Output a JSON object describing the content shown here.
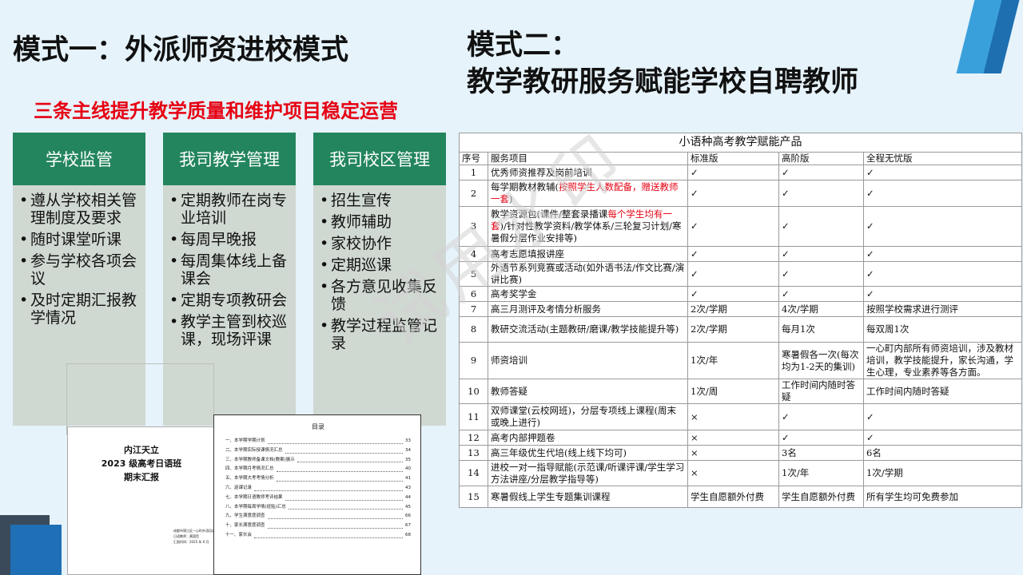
{
  "mode1": {
    "title": "模式一：外派师资进校模式"
  },
  "mode2": {
    "title_line1": "模式二：",
    "title_line2": "教学教研服务赋能学校自聘教师"
  },
  "subtitle": "三条主线提升教学质量和维护项目稳定运营",
  "columns": [
    {
      "header": "学校监管",
      "items": [
        "遵从学校相关管理制度及要求",
        "随时课堂听课",
        "参与学校各项会议",
        "及时定期汇报教学情况"
      ]
    },
    {
      "header": "我司教学管理",
      "items": [
        "定期教师在岗专业培训",
        "每周早晚报",
        "每周集体线上备课会",
        "定期专项教研会",
        "教学主管到校巡课，现场评课"
      ]
    },
    {
      "header": "我司校区管理",
      "items": [
        "招生宣传",
        "教师辅助",
        "家校协作",
        "定期巡课",
        "各方意见收集反馈",
        "教学过程监管记录"
      ]
    }
  ],
  "report_cover": {
    "line1": "内江天立",
    "line2": "2023 级高考日语班",
    "line3": "期末汇报",
    "meta": [
      "成都市锦江区一心町外语培训学校",
      "日语教师：黄国哲",
      "汇报时间：2025 年 6 月"
    ]
  },
  "toc": {
    "title": "目录",
    "entries": [
      {
        "t": "一、本学期学期计划",
        "p": "33"
      },
      {
        "t": "二、本学期实际授课情况汇总",
        "p": "34"
      },
      {
        "t": "三、本学期教师备课文档(教案)展示",
        "p": "35"
      },
      {
        "t": "四、本学期月考情况汇总",
        "p": "40"
      },
      {
        "t": "五、本学期大考考情分析",
        "p": "41"
      },
      {
        "t": "六、巡课记录",
        "p": "43"
      },
      {
        "t": "七、本学期日语教师考评结果",
        "p": "44"
      },
      {
        "t": "八、本学期每周学情(班貼)汇总",
        "p": "45"
      },
      {
        "t": "九、学生满意度调查",
        "p": "66"
      },
      {
        "t": "十、家长满意度调查",
        "p": "67"
      },
      {
        "t": "十一、家长会",
        "p": "68"
      }
    ]
  },
  "table": {
    "caption": "小语种高考教学赋能产品",
    "headers": [
      "序号",
      "服务项目",
      "标准版",
      "高阶版",
      "全程无忧版"
    ],
    "rows": [
      {
        "n": "1",
        "item": "优秀师资推荐及岗前培训",
        "std": "✓",
        "adv": "✓",
        "full": "✓"
      },
      {
        "n": "2",
        "item": "每学期教材教辅(",
        "item_red": "按照学生人数配备，赠送教师一套",
        "item_tail": ")",
        "std": "✓",
        "adv": "✓",
        "full": "✓"
      },
      {
        "n": "3",
        "item": "教学资源包(课件/整套录播课",
        "item_red": "每个学生均有一套",
        "item_tail": ")/针对性教学资料/教学体系/三轮复习计划/寒暑假分层作业安排等)",
        "std": "✓",
        "adv": "✓",
        "full": "✓"
      },
      {
        "n": "4",
        "item": "高考志愿填报讲座",
        "std": "✓",
        "adv": "✓",
        "full": "✓"
      },
      {
        "n": "5",
        "item": "外语节系列竞赛或活动(如外语书法/作文比赛/演讲比赛)",
        "std": "✓",
        "adv": "✓",
        "full": "✓"
      },
      {
        "n": "6",
        "item": "高考奖学金",
        "std": "✓",
        "adv": "✓",
        "full": "✓"
      },
      {
        "n": "7",
        "item": "高三月测评及考情分析服务",
        "std": "2次/学期",
        "adv": "4次/学期",
        "full": "按照学校需求进行测评"
      },
      {
        "n": "8",
        "item": "教研交流活动(主题教研/磨课/教学技能提升等)",
        "std": "2次/学期",
        "adv": "每月1次",
        "full": "每双周1次"
      },
      {
        "n": "9",
        "item": "师资培训",
        "std": "1次/年",
        "adv": "寒暑假各一次(每次均为1-2天的集训)",
        "full": "一心町内部所有师资培训，涉及教材培训，教学技能提升，家长沟通，学生心理，专业素养等各方面。"
      },
      {
        "n": "10",
        "item": "教师答疑",
        "std": "1次/周",
        "adv": "工作时间内随时答疑",
        "full": "工作时间内随时答疑"
      },
      {
        "n": "11",
        "item": "双师课堂(云校网班)，分层专项线上课程(周末或晚上进行)",
        "std": "×",
        "adv": "✓",
        "full": "✓"
      },
      {
        "n": "12",
        "item": "高考内部押题卷",
        "std": "×",
        "adv": "✓",
        "full": "✓"
      },
      {
        "n": "13",
        "item": "高三年级优生代培(线上线下均可)",
        "std": "×",
        "adv": "3名",
        "full": "6名"
      },
      {
        "n": "14",
        "item": "进校一对一指导赋能(示范课/听课评课/学生学习方法讲座/分层教学指导等)",
        "std": "×",
        "adv": "1次/年",
        "full": "1次/学期"
      },
      {
        "n": "15",
        "item": "寒暑假线上学生专题集训课程",
        "std": "学生自愿额外付费",
        "adv": "学生自愿额外付费",
        "full": "所有学生均可免费参加"
      }
    ]
  },
  "watermark": "试用水印"
}
